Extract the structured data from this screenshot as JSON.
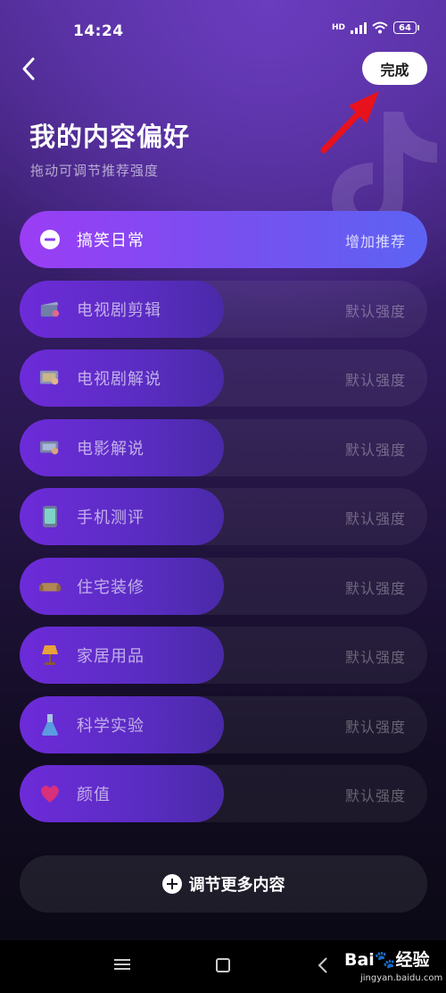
{
  "status": {
    "time": "14:24",
    "hd": "HD",
    "battery": "64"
  },
  "header": {
    "done_label": "完成",
    "title": "我的内容偏好",
    "subtitle": "拖动可调节推荐强度"
  },
  "preferences": [
    {
      "label": "搞笑日常",
      "strength": "增加推荐",
      "level": 1.0,
      "icon": "minus-circle-icon"
    },
    {
      "label": "电视剧剪辑",
      "strength": "默认强度",
      "level": 0.5,
      "icon": "film-clapper-icon"
    },
    {
      "label": "电视剧解说",
      "strength": "默认强度",
      "level": 0.5,
      "icon": "tv-presenter-icon"
    },
    {
      "label": "电影解说",
      "strength": "默认强度",
      "level": 0.5,
      "icon": "movie-screen-icon"
    },
    {
      "label": "手机测评",
      "strength": "默认强度",
      "level": 0.5,
      "icon": "phone-icon"
    },
    {
      "label": "住宅装修",
      "strength": "默认强度",
      "level": 0.5,
      "icon": "sofa-icon"
    },
    {
      "label": "家居用品",
      "strength": "默认强度",
      "level": 0.5,
      "icon": "lamp-icon"
    },
    {
      "label": "科学实验",
      "strength": "默认强度",
      "level": 0.5,
      "icon": "flask-icon"
    },
    {
      "label": "颜值",
      "strength": "默认强度",
      "level": 0.5,
      "icon": "heart-icon"
    }
  ],
  "more_button": {
    "label": "调节更多内容"
  },
  "watermark": {
    "main": "Bai🐾经验",
    "sub": "jingyan.baidu.com"
  },
  "colors": {
    "accent_start": "#9b3df5",
    "accent_end": "#5c63f2",
    "fill": "#5a2cc2",
    "arrow": "#e8121c"
  }
}
